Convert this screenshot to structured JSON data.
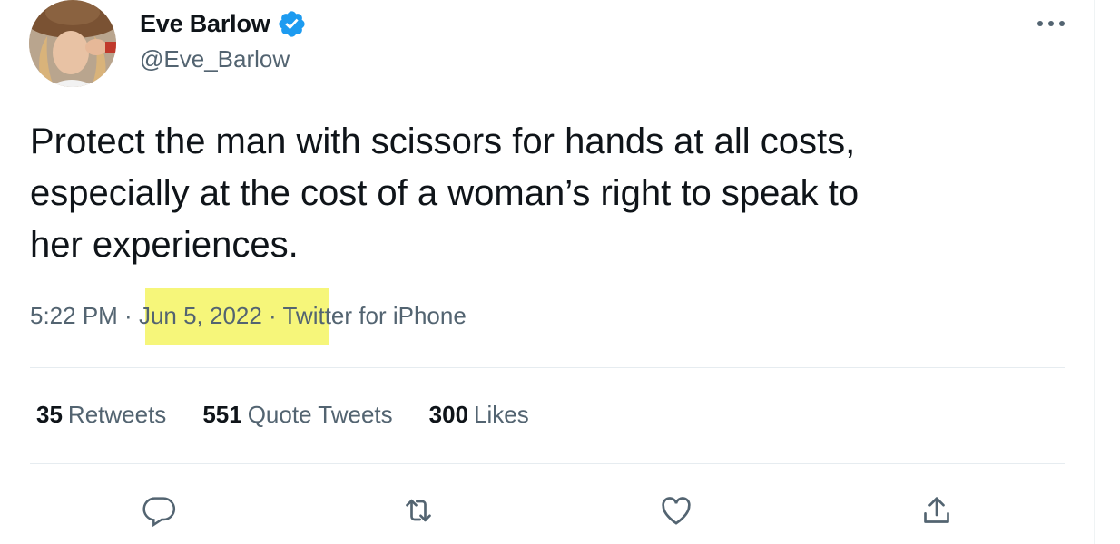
{
  "author": {
    "display_name": "Eve Barlow",
    "handle": "@Eve_Barlow",
    "verified": true
  },
  "tweet": {
    "text": "Protect the man with scissors for hands at all costs,\nespecially at the cost of a woman’s right to speak to\nher experiences.",
    "time": "5:22 PM",
    "separator": " · ",
    "date": "Jun 5, 2022",
    "source": "Twitter for iPhone"
  },
  "stats": [
    {
      "count": "35",
      "label": "Retweets"
    },
    {
      "count": "551",
      "label": "Quote Tweets"
    },
    {
      "count": "300",
      "label": "Likes"
    }
  ],
  "icons": {
    "more": "more-horizontal-icon",
    "reply": "reply-icon",
    "retweet": "retweet-icon",
    "like": "heart-icon",
    "share": "share-icon",
    "verified": "verified-badge-icon"
  },
  "colors": {
    "text": "#0f1419",
    "secondary": "#536471",
    "verified": "#1d9bf0",
    "highlight": "#f6f67a"
  }
}
